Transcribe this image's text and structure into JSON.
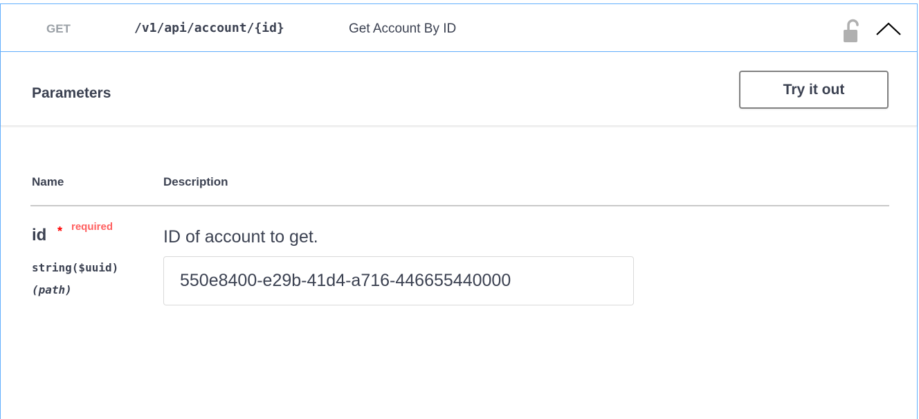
{
  "operation": {
    "method": "GET",
    "path": "/v1/api/account/{id}",
    "summary": "Get Account By ID",
    "lock_icon": "unlock-icon",
    "collapse_icon": "chevron-up-icon"
  },
  "parameters_section": {
    "title": "Parameters",
    "try_it_out_label": "Try it out",
    "columns": {
      "name": "Name",
      "description": "Description"
    },
    "params": [
      {
        "name": "id",
        "required_marker": "*",
        "required_label": "required",
        "type": "string($uuid)",
        "location": "(path)",
        "description": "ID of account to get.",
        "value": "550e8400-e29b-41d4-a716-446655440000"
      }
    ]
  },
  "colors": {
    "accent_border": "#61affe",
    "required": "#ff0000",
    "text": "#3b4151"
  }
}
